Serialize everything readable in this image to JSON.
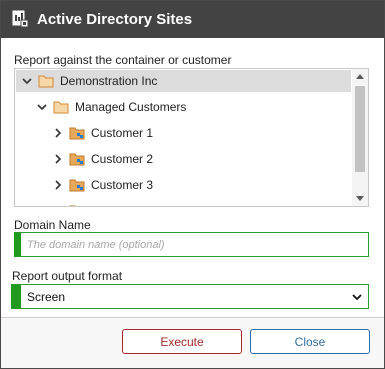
{
  "window": {
    "title": "Active Directory Sites",
    "icon": "report-sites-icon"
  },
  "container_picker": {
    "label": "Report against the container or customer",
    "tree": [
      {
        "label": "Demonstration Inc",
        "expanded": true,
        "selected": true,
        "icon": "folder-icon"
      },
      {
        "label": "Managed Customers",
        "expanded": true,
        "icon": "folder-icon"
      },
      {
        "label": "Customer 1",
        "expanded": false,
        "icon": "customer-folder-icon"
      },
      {
        "label": "Customer 2",
        "expanded": false,
        "icon": "customer-folder-icon"
      },
      {
        "label": "Customer 3",
        "expanded": false,
        "icon": "customer-folder-icon"
      }
    ]
  },
  "domain": {
    "label": "Domain Name",
    "value": "",
    "placeholder": "The domain name (optional)"
  },
  "output_format": {
    "label": "Report output format",
    "selected": "Screen"
  },
  "buttons": {
    "execute": "Execute",
    "close": "Close"
  },
  "colors": {
    "titlebar": "#434343",
    "valid_accent": "#1f9a1f",
    "execute": "#a32a2a",
    "close": "#2f6ea5",
    "folder": "#e8a95b"
  }
}
